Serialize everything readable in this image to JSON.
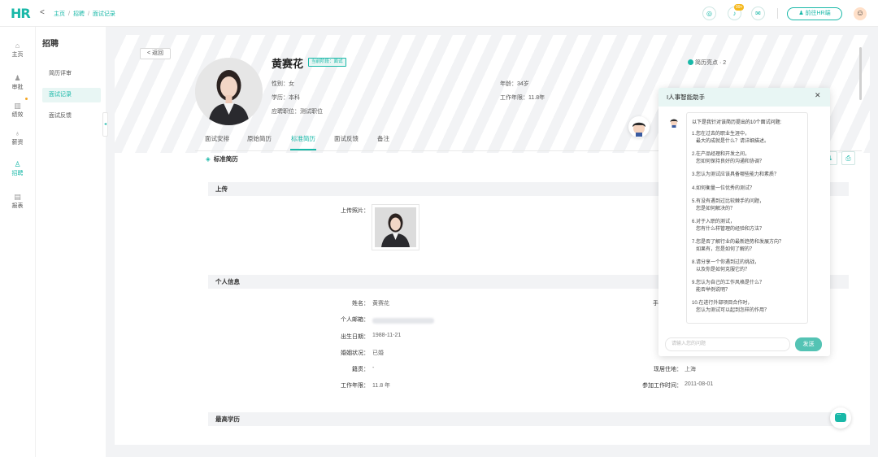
{
  "app": {
    "logo": "HR"
  },
  "breadcrumb": [
    "主页",
    "招聘",
    "面试记录"
  ],
  "topbar": {
    "badge": "99+",
    "hr_button": "前往HR端"
  },
  "leftnav": [
    {
      "label": "主页",
      "icon": "home-icon",
      "glyph": "⌂"
    },
    {
      "label": "审批",
      "icon": "person-icon",
      "glyph": "♟"
    },
    {
      "label": "绩效",
      "icon": "bar-chart-icon",
      "glyph": "▥"
    },
    {
      "label": "薪资",
      "icon": "money-bag-icon",
      "glyph": "♁"
    },
    {
      "label": "招聘",
      "icon": "recruit-icon",
      "glyph": "♙"
    },
    {
      "label": "报表",
      "icon": "report-icon",
      "glyph": "▤"
    }
  ],
  "subnav": {
    "title": "招聘",
    "items": [
      "简历评审",
      "面试记录",
      "面试反馈"
    ]
  },
  "profile": {
    "back": "返回",
    "name": "黄赛花",
    "stage": "当前阶段：面试",
    "gender": "性别：女",
    "education": "学历：本科",
    "position": "应聘职位：测试职位",
    "age": "年龄：34岁",
    "years": "工作年限：11.8年",
    "highlight": "简历亮点 · 2"
  },
  "tabs": [
    "面试安排",
    "原始简历",
    "标准简历",
    "面试反馈",
    "备注"
  ],
  "std_title": "标准简历",
  "sections": {
    "upload": "上传",
    "personal": "个人信息",
    "edu": "最高学历"
  },
  "upload_label": "上传照片：",
  "personal": {
    "name_label": "姓名：",
    "name": "黄赛花",
    "email_label": "个人邮箱：",
    "birth_label": "出生日期：",
    "birth": "1988-11-21",
    "marital_label": "婚姻状况：",
    "marital": "已婚",
    "origin_label": "籍贯：",
    "origin": "-",
    "years_label": "工作年限：",
    "years": "11.8 年",
    "phone_label_partial": "手",
    "residence_label": "现居住地：",
    "residence": "上海",
    "workstart_label": "参加工作时间：",
    "workstart": "2011-08-01"
  },
  "assistant": {
    "title": "I人事智能助手",
    "intro": "以下是我针对该简历提出的10个面试问题:",
    "questions": [
      {
        "a": "1.您在过去的职业生涯中，",
        "b": "最大的成就是什么？请详细描述。"
      },
      {
        "a": "2.在产品经理和开发之间，",
        "b": "您如何保持良好的沟通和协调？"
      },
      {
        "a": "3.您认为测试应该具备哪些能力和素质？",
        "b": ""
      },
      {
        "a": "4.如何衡量一位优秀的测试？",
        "b": ""
      },
      {
        "a": "5.有没有遇到过比较棘手的问题，",
        "b": "您是如何解决的？"
      },
      {
        "a": "6.对于入职的测试，",
        "b": "您有什么样管理的经验和方法？"
      },
      {
        "a": "7.您是否了解行业的最新趋势和发展方向？",
        "b": "如果有，您是如何了解的？"
      },
      {
        "a": "8.请分享一个你遇到过的挑战，",
        "b": "以及你是如何克服它的？"
      },
      {
        "a": "9.您认为自己的工作风格是什么？",
        "b": "能否举例说明？"
      },
      {
        "a": "10.在进行外部项目合作时，",
        "b": "您认为测试可以起到怎样的作用？"
      }
    ],
    "input_placeholder": "请输入您的问题",
    "send": "发送"
  }
}
